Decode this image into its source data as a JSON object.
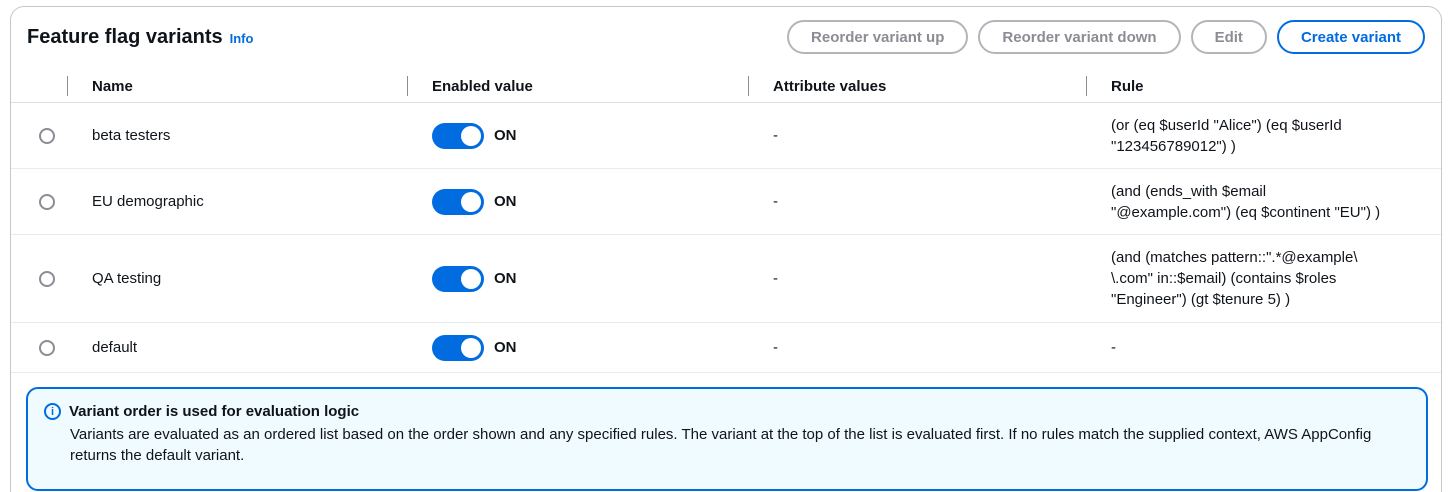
{
  "header": {
    "title": "Feature flag variants",
    "info": "Info",
    "buttons": {
      "reorder_up": "Reorder variant up",
      "reorder_down": "Reorder variant down",
      "edit": "Edit",
      "create": "Create variant"
    }
  },
  "table": {
    "columns": [
      "Name",
      "Enabled value",
      "Attribute values",
      "Rule"
    ],
    "rows": [
      {
        "name": "beta testers",
        "enabled": "ON",
        "attributes": "-",
        "rule": "(or (eq $userId \"Alice\") (eq $userId\n\"123456789012\") )"
      },
      {
        "name": "EU demographic",
        "enabled": "ON",
        "attributes": "-",
        "rule": "(and (ends_with $email\n\"@example.com\") (eq $continent \"EU\") )"
      },
      {
        "name": "QA testing",
        "enabled": "ON",
        "attributes": "-",
        "rule": "(and (matches pattern::\".*@example\\\n\\.com\" in::$email) (contains $roles\n\"Engineer\") (gt $tenure 5) )"
      },
      {
        "name": "default",
        "enabled": "ON",
        "attributes": "-",
        "rule": "-"
      }
    ]
  },
  "alert": {
    "title": "Variant order is used for evaluation logic",
    "body": "Variants are evaluated as an ordered list based on the order shown and any specified rules. The variant at the top of the list is evaluated first. If no rules match the supplied context, AWS AppConfig returns the default variant."
  },
  "colors": {
    "accent": "#006ce0",
    "alert_background": "#f0fbff",
    "disabled_border": "#b4b4bb"
  }
}
